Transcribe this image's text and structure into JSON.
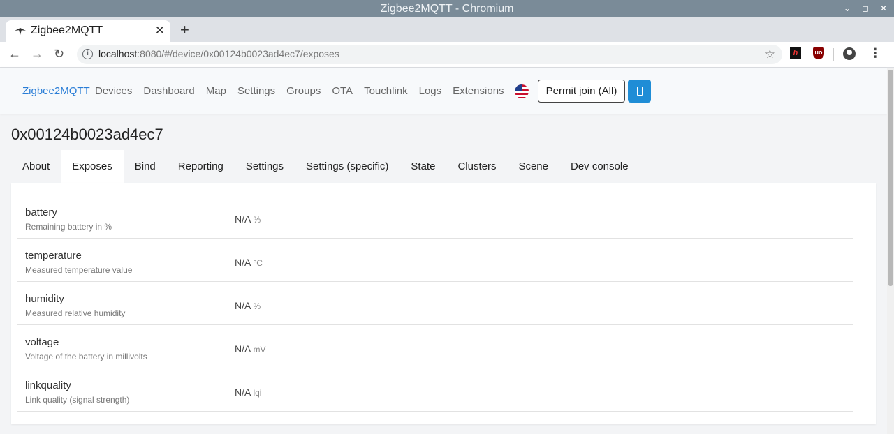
{
  "window": {
    "title": "Zigbee2MQTT - Chromium"
  },
  "browser": {
    "tab_title": "Zigbee2MQTT",
    "url_host": "localhost",
    "url_rest": ":8080/#/device/0x00124b0023ad4ec7/exposes"
  },
  "navbar": {
    "brand": "Zigbee2MQTT",
    "links": [
      "Devices",
      "Dashboard",
      "Map",
      "Settings",
      "Groups",
      "OTA",
      "Touchlink",
      "Logs",
      "Extensions"
    ],
    "permit_join": "Permit join (All)",
    "language_icon": "us-flag-icon"
  },
  "device": {
    "title": "0x00124b0023ad4ec7",
    "tabs": [
      "About",
      "Exposes",
      "Bind",
      "Reporting",
      "Settings",
      "Settings (specific)",
      "State",
      "Clusters",
      "Scene",
      "Dev console"
    ],
    "active_tab": "Exposes"
  },
  "exposes": [
    {
      "name": "battery",
      "description": "Remaining battery in %",
      "value": "N/A",
      "unit": "%"
    },
    {
      "name": "temperature",
      "description": "Measured temperature value",
      "value": "N/A",
      "unit": "°C"
    },
    {
      "name": "humidity",
      "description": "Measured relative humidity",
      "value": "N/A",
      "unit": "%"
    },
    {
      "name": "voltage",
      "description": "Voltage of the battery in millivolts",
      "value": "N/A",
      "unit": "mV"
    },
    {
      "name": "linkquality",
      "description": "Link quality (signal strength)",
      "value": "N/A",
      "unit": "lqi"
    }
  ],
  "colors": {
    "accent": "#2a7dd6",
    "button_blue": "#1f8dd6"
  }
}
